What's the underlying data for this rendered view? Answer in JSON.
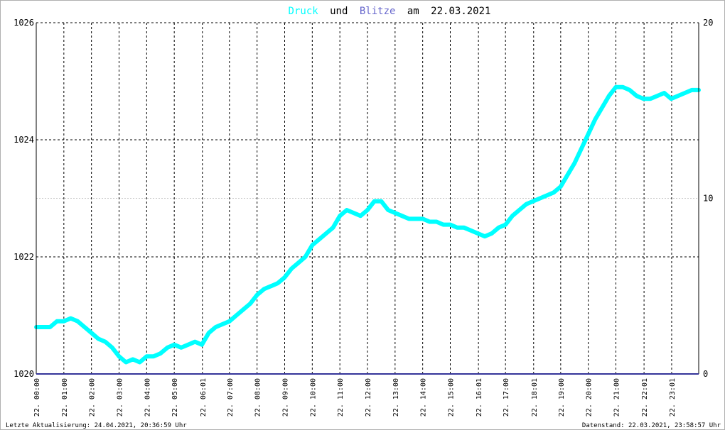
{
  "chart_data": {
    "type": "line",
    "title_parts": {
      "series1": "Druck",
      "conj": "und",
      "series2": "Blitze",
      "prep": "am",
      "date": "22.03.2021"
    },
    "colors": {
      "pressure": "#00ffff",
      "lightning": "#333399",
      "title_lightning": "#6666cc",
      "grid": "#000000",
      "grid_minor": "#c8c8c8"
    },
    "y_left": {
      "range": [
        1020,
        1026
      ],
      "ticks": [
        "1020",
        "1022",
        "1024",
        "1026"
      ]
    },
    "y_right": {
      "range": [
        0,
        20
      ],
      "ticks": [
        "0",
        "10",
        "20"
      ]
    },
    "x_ticks": [
      "22. 00:00",
      "22. 01:00",
      "22. 02:00",
      "22. 03:00",
      "22. 04:00",
      "22. 05:00",
      "22. 06:01",
      "22. 07:00",
      "22. 08:00",
      "22. 09:00",
      "22. 10:00",
      "22. 11:00",
      "22. 12:00",
      "22. 13:00",
      "22. 14:00",
      "22. 15:00",
      "22. 16:01",
      "22. 17:00",
      "22. 18:01",
      "22. 19:00",
      "22. 20:00",
      "22. 21:00",
      "22. 22:01",
      "22. 23:01"
    ],
    "x_tick_hours": [
      0,
      1,
      2,
      3,
      4,
      5,
      6.02,
      7,
      8,
      9,
      10,
      11,
      12,
      13,
      14,
      15,
      16.02,
      17,
      18.02,
      19,
      20,
      21,
      22.02,
      23.02
    ],
    "grid": true,
    "series": [
      {
        "name": "Druck",
        "axis": "left",
        "x_hours": [
          0,
          0.25,
          0.5,
          0.75,
          1,
          1.25,
          1.5,
          1.75,
          2,
          2.25,
          2.5,
          2.75,
          3,
          3.25,
          3.5,
          3.75,
          4,
          4.25,
          4.5,
          4.75,
          5,
          5.25,
          5.5,
          5.75,
          6,
          6.25,
          6.5,
          6.75,
          7,
          7.25,
          7.5,
          7.75,
          8,
          8.25,
          8.5,
          8.75,
          9,
          9.25,
          9.5,
          9.75,
          10,
          10.25,
          10.5,
          10.75,
          11,
          11.25,
          11.5,
          11.75,
          12,
          12.25,
          12.5,
          12.75,
          13,
          13.25,
          13.5,
          13.75,
          14,
          14.25,
          14.5,
          14.75,
          15,
          15.25,
          15.5,
          15.75,
          16,
          16.25,
          16.5,
          16.75,
          17,
          17.25,
          17.5,
          17.75,
          18,
          18.25,
          18.5,
          18.75,
          19,
          19.25,
          19.5,
          19.75,
          20,
          20.25,
          20.5,
          20.75,
          21,
          21.25,
          21.5,
          21.75,
          22,
          22.25,
          22.5,
          22.75,
          23,
          23.25,
          23.5,
          23.75,
          24
        ],
        "values": [
          1020.8,
          1020.8,
          1020.8,
          1020.9,
          1020.9,
          1020.95,
          1020.9,
          1020.8,
          1020.7,
          1020.6,
          1020.55,
          1020.45,
          1020.3,
          1020.2,
          1020.25,
          1020.2,
          1020.3,
          1020.3,
          1020.35,
          1020.45,
          1020.5,
          1020.45,
          1020.5,
          1020.55,
          1020.5,
          1020.7,
          1020.8,
          1020.85,
          1020.9,
          1021.0,
          1021.1,
          1021.2,
          1021.35,
          1021.45,
          1021.5,
          1021.55,
          1021.65,
          1021.8,
          1021.9,
          1022.0,
          1022.2,
          1022.3,
          1022.4,
          1022.5,
          1022.7,
          1022.8,
          1022.75,
          1022.7,
          1022.8,
          1022.95,
          1022.95,
          1022.8,
          1022.75,
          1022.7,
          1022.65,
          1022.65,
          1022.65,
          1022.6,
          1022.6,
          1022.55,
          1022.55,
          1022.5,
          1022.5,
          1022.45,
          1022.4,
          1022.35,
          1022.4,
          1022.5,
          1022.55,
          1022.7,
          1022.8,
          1022.9,
          1022.95,
          1023.0,
          1023.05,
          1023.1,
          1023.2,
          1023.4,
          1023.6,
          1023.85,
          1024.1,
          1024.35,
          1024.55,
          1024.75,
          1024.9,
          1024.9,
          1024.85,
          1024.75,
          1024.7,
          1024.7,
          1024.75,
          1024.8,
          1024.7,
          1024.75,
          1024.8,
          1024.85,
          1024.85
        ]
      },
      {
        "name": "Blitze",
        "axis": "right",
        "x_hours": [
          0,
          24
        ],
        "values": [
          0,
          0
        ]
      }
    ]
  },
  "footer": {
    "left": "Letzte Aktualisierung: 24.04.2021, 20:36:59 Uhr",
    "right": "Datenstand: 22.03.2021, 23:58:57 Uhr"
  }
}
